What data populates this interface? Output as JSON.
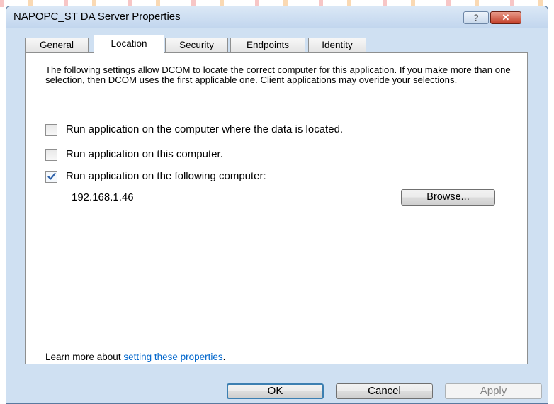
{
  "window": {
    "title": "NAPOPC_ST DA Server Properties",
    "help_label": "?",
    "close_label": "✕"
  },
  "tabs": [
    {
      "label": "General",
      "active": false
    },
    {
      "label": "Location",
      "active": true
    },
    {
      "label": "Security",
      "active": false
    },
    {
      "label": "Endpoints",
      "active": false
    },
    {
      "label": "Identity",
      "active": false
    }
  ],
  "location": {
    "description": "The following settings allow DCOM to locate the correct computer for this application. If you make more than one selection, then DCOM uses the first applicable one. Client applications may overide your selections.",
    "options": [
      {
        "label": "Run application on the computer where the data is located.",
        "checked": false
      },
      {
        "label": "Run application on this computer.",
        "checked": false
      },
      {
        "label": "Run application on the following computer:",
        "checked": true
      }
    ],
    "computer_value": "192.168.1.46",
    "browse_label": "Browse...",
    "learn_more_prefix": "Learn more about ",
    "learn_more_link": "setting these properties",
    "learn_more_suffix": "."
  },
  "buttons": {
    "ok_label": "OK",
    "cancel_label": "Cancel",
    "apply_label": "Apply"
  }
}
